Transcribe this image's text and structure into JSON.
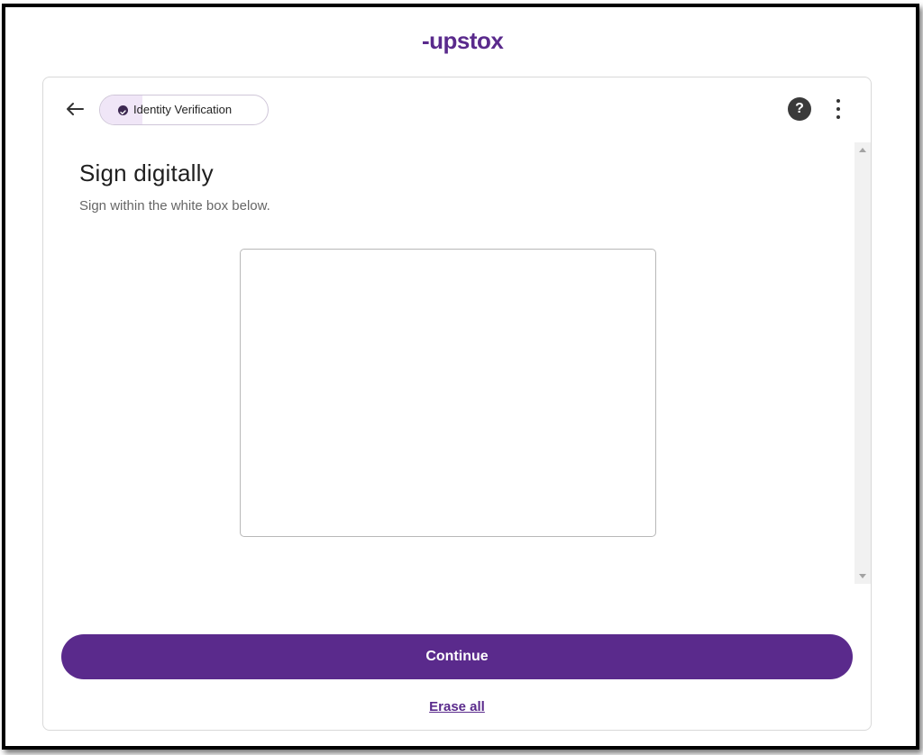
{
  "brand": {
    "logo_text": "upstox",
    "accent_color": "#5a2a8c"
  },
  "header": {
    "back_icon": "arrow-left-icon",
    "step": {
      "label": "Identity Verification",
      "icon": "check-circle-icon",
      "progress": 0.25
    },
    "help_icon": "question-circle-icon",
    "help_glyph": "?",
    "menu_icon": "more-vertical-icon"
  },
  "content": {
    "title": "Sign digitally",
    "subtitle": "Sign within the white box below."
  },
  "actions": {
    "continue_label": "Continue",
    "erase_label": "Erase all"
  }
}
